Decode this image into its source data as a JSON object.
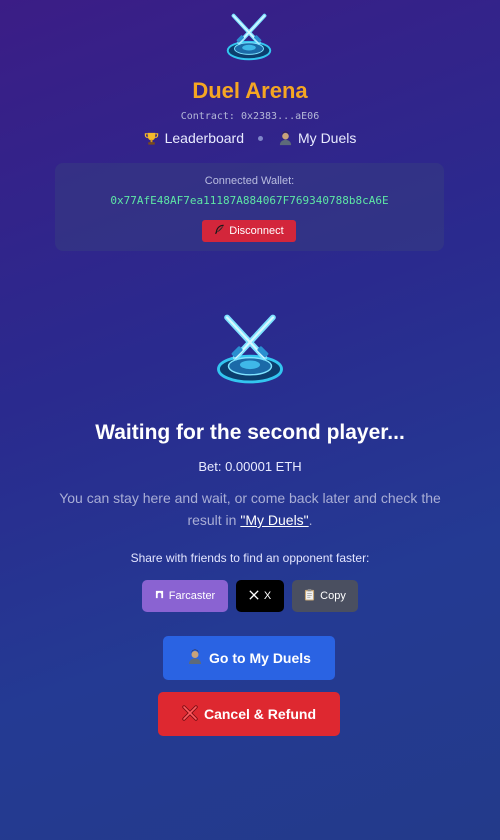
{
  "header": {
    "title": "Duel Arena",
    "contract": "Contract: 0x2383...aE06",
    "nav": {
      "leaderboard": "Leaderboard",
      "my_duels": "My Duels"
    }
  },
  "wallet": {
    "label": "Connected Wallet:",
    "address": "0x77AfE48AF7ea11187A884067F769340788b8cA6E",
    "disconnect_label": "Disconnect"
  },
  "status": {
    "heading": "Waiting for the second player...",
    "bet": "Bet: 0.00001 ETH",
    "description_prefix": "You can stay here and wait, or come back later and check the result in ",
    "description_link": "\"My Duels\"",
    "description_suffix": "."
  },
  "share": {
    "label": "Share with friends to find an opponent faster:",
    "farcaster": "Farcaster",
    "x": "X",
    "copy": "Copy"
  },
  "actions": {
    "go_to_my_duels": "Go to My Duels",
    "cancel_refund": "Cancel & Refund"
  },
  "colors": {
    "accent_title": "#f5a623",
    "wallet_address": "#5ee6a6",
    "disconnect": "#d3263b",
    "primary_button": "#2a63e3",
    "danger_button": "#de2830",
    "farcaster": "#8a63d2"
  },
  "icons": [
    "arena-logo-icon",
    "trophy-icon",
    "user-icon",
    "feather-icon",
    "farcaster-icon",
    "x-logo-icon",
    "clipboard-icon",
    "cross-icon"
  ]
}
